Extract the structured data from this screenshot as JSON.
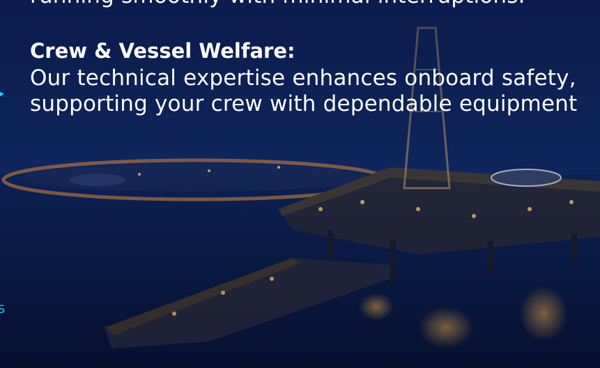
{
  "intro": {
    "line": "running smoothly with minimal interruptions."
  },
  "crew_welfare": {
    "heading": "Crew & Vessel Welfare:",
    "body_line1": "Our technical expertise enhances onboard safety,",
    "body_line2": "supporting your crew with dependable equipment"
  },
  "side": {
    "glyph": "S"
  },
  "icons": {
    "side_arrow": "chevron-right-icon"
  },
  "colors": {
    "background": "#0a1a3d",
    "accent": "#2ec4ff",
    "text": "#ffffff"
  }
}
